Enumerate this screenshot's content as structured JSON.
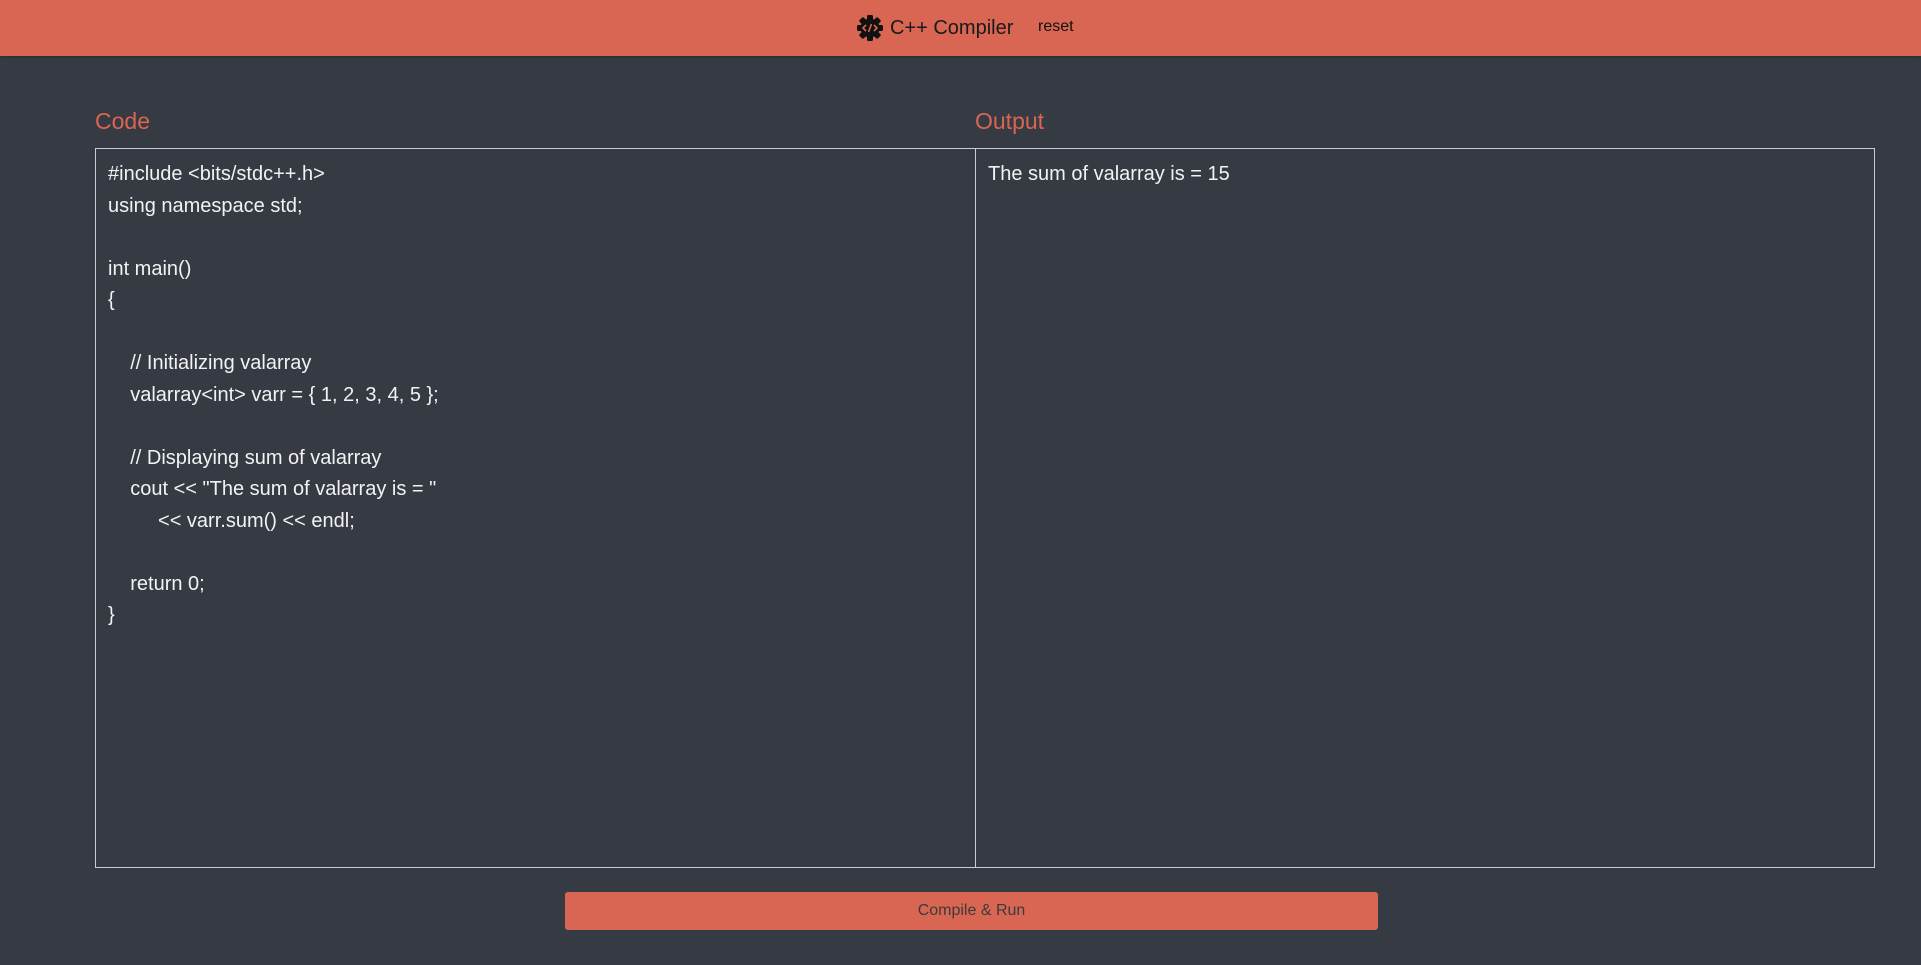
{
  "header": {
    "title": "C++ Compiler",
    "reset_label": "reset",
    "logo_icon": "code-gear-icon"
  },
  "editor": {
    "label": "Code",
    "code": "#include <bits/stdc++.h>\nusing namespace std;\n\nint main()\n{\n\n    // Initializing valarray\n    valarray<int> varr = { 1, 2, 3, 4, 5 };\n\n    // Displaying sum of valarray\n    cout << \"The sum of valarray is = \"\n         << varr.sum() << endl;\n\n    return 0;\n}"
  },
  "output": {
    "label": "Output",
    "text": "The sum of valarray is = 15"
  },
  "actions": {
    "run_label": "Compile & Run"
  },
  "colors": {
    "accent": "#d96652",
    "background": "#363a43",
    "text": "#f2f2f2"
  }
}
